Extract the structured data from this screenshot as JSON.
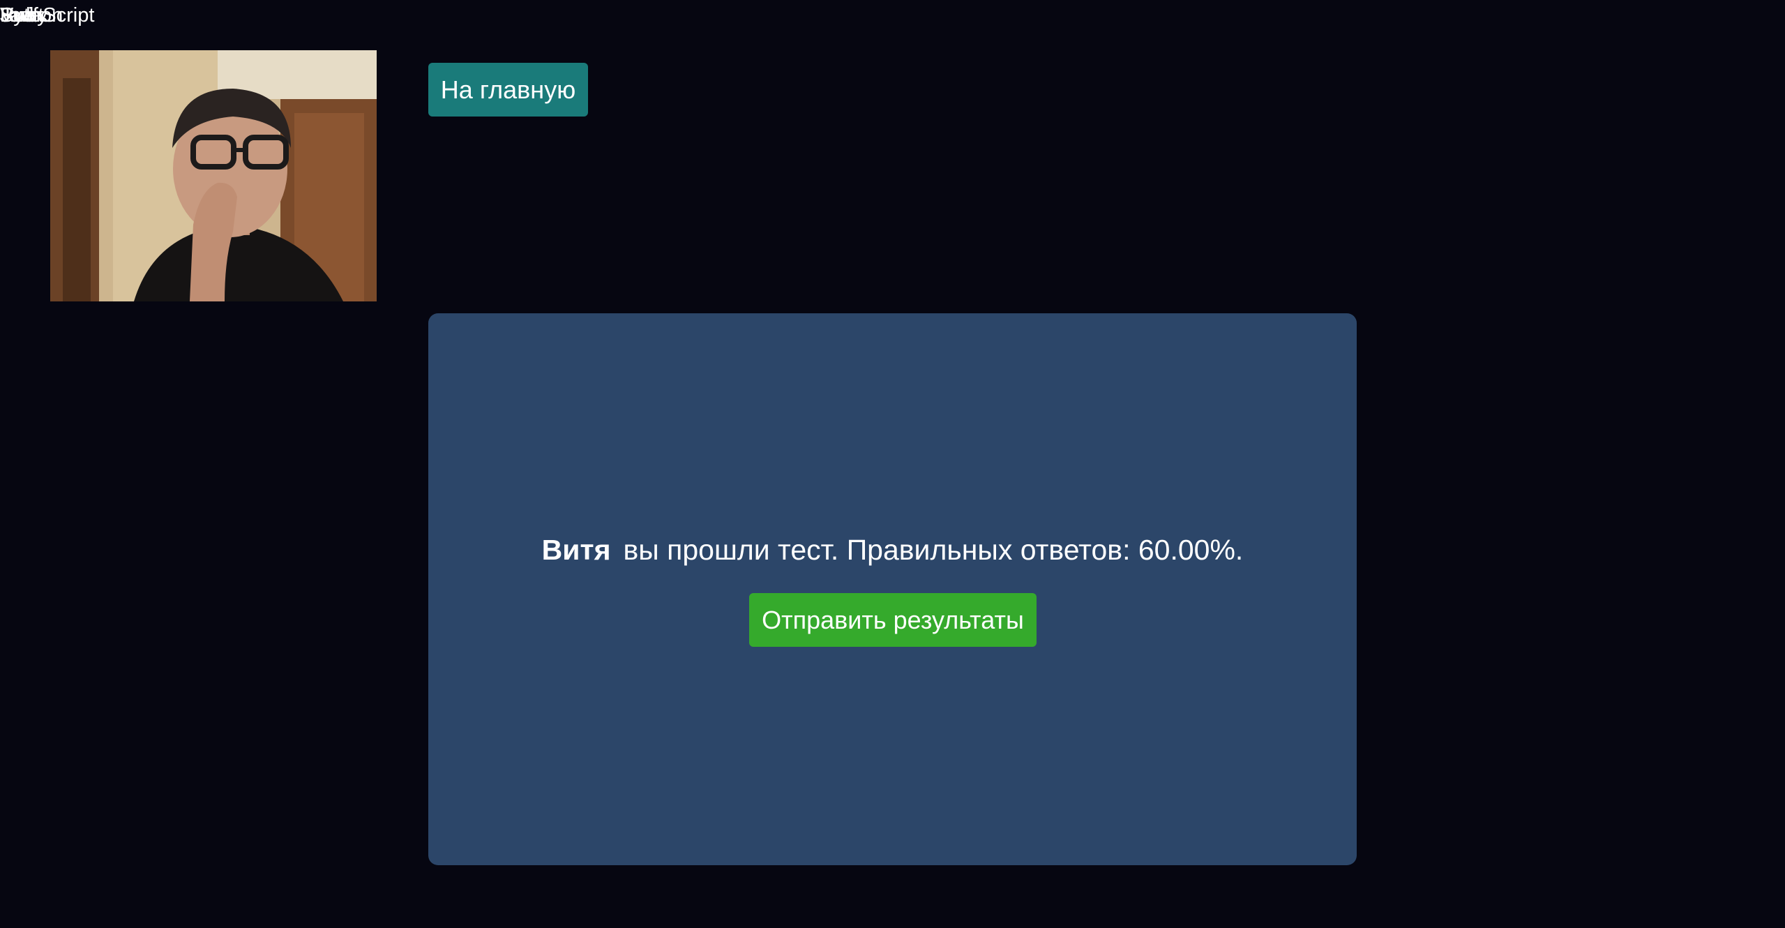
{
  "topbar": {
    "overlapping_labels": [
      "JavaScript",
      "Vue",
      "Java",
      "Python",
      "Ruby",
      "Swift"
    ]
  },
  "webcam": {
    "content": "webcam-video-feed"
  },
  "header": {
    "home_label": "На главную"
  },
  "result": {
    "user_name": "Витя",
    "message": "вы прошли тест. Правильных ответов: 60.00%.",
    "send_label": "Отправить результаты"
  },
  "colors": {
    "background": "#060611",
    "home_button": "#1a7b7a",
    "card": "#2c4669",
    "send_button": "#35aa2c",
    "text": "#ffffff"
  }
}
